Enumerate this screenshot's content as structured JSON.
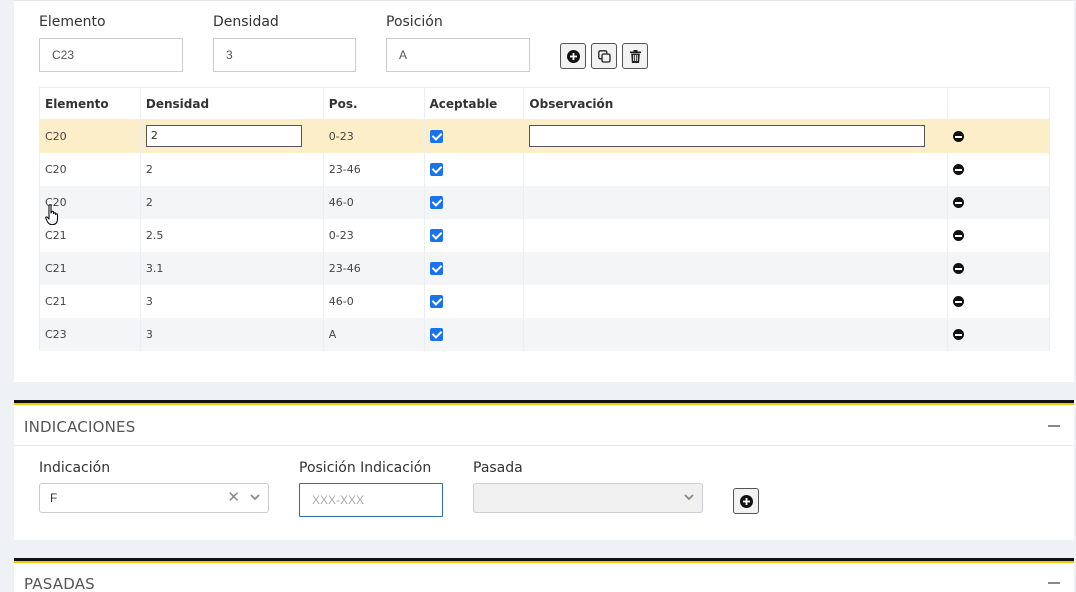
{
  "form": {
    "elemento_label": "Elemento",
    "elemento_value": "C23",
    "densidad_label": "Densidad",
    "densidad_value": "3",
    "posicion_label": "Posición",
    "posicion_value": "A"
  },
  "table": {
    "headers": [
      "Elemento",
      "Densidad",
      "Pos.",
      "Aceptable",
      "Observación",
      ""
    ],
    "rows": [
      {
        "elemento": "C20",
        "densidad": "2",
        "pos": "0-23",
        "aceptable": true,
        "observacion": ""
      },
      {
        "elemento": "C20",
        "densidad": "2",
        "pos": "23-46",
        "aceptable": true,
        "observacion": ""
      },
      {
        "elemento": "C20",
        "densidad": "2",
        "pos": "46-0",
        "aceptable": true,
        "observacion": ""
      },
      {
        "elemento": "C21",
        "densidad": "2.5",
        "pos": "0-23",
        "aceptable": true,
        "observacion": ""
      },
      {
        "elemento": "C21",
        "densidad": "3.1",
        "pos": "23-46",
        "aceptable": true,
        "observacion": ""
      },
      {
        "elemento": "C21",
        "densidad": "3",
        "pos": "46-0",
        "aceptable": true,
        "observacion": ""
      },
      {
        "elemento": "C23",
        "densidad": "3",
        "pos": "A",
        "aceptable": true,
        "observacion": ""
      }
    ]
  },
  "indicaciones": {
    "title": "INDICACIONES",
    "indicacion_label": "Indicación",
    "indicacion_value": "F",
    "posicion_label": "Posición Indicación",
    "posicion_placeholder": "XXX-XXX",
    "pasada_label": "Pasada",
    "pasada_value": ""
  },
  "pasadas": {
    "title": "PASADAS"
  },
  "colors": {
    "accent_yellow": "#f2c811",
    "selected_row": "#fbeec8",
    "checkbox_blue": "#1a73e8"
  }
}
